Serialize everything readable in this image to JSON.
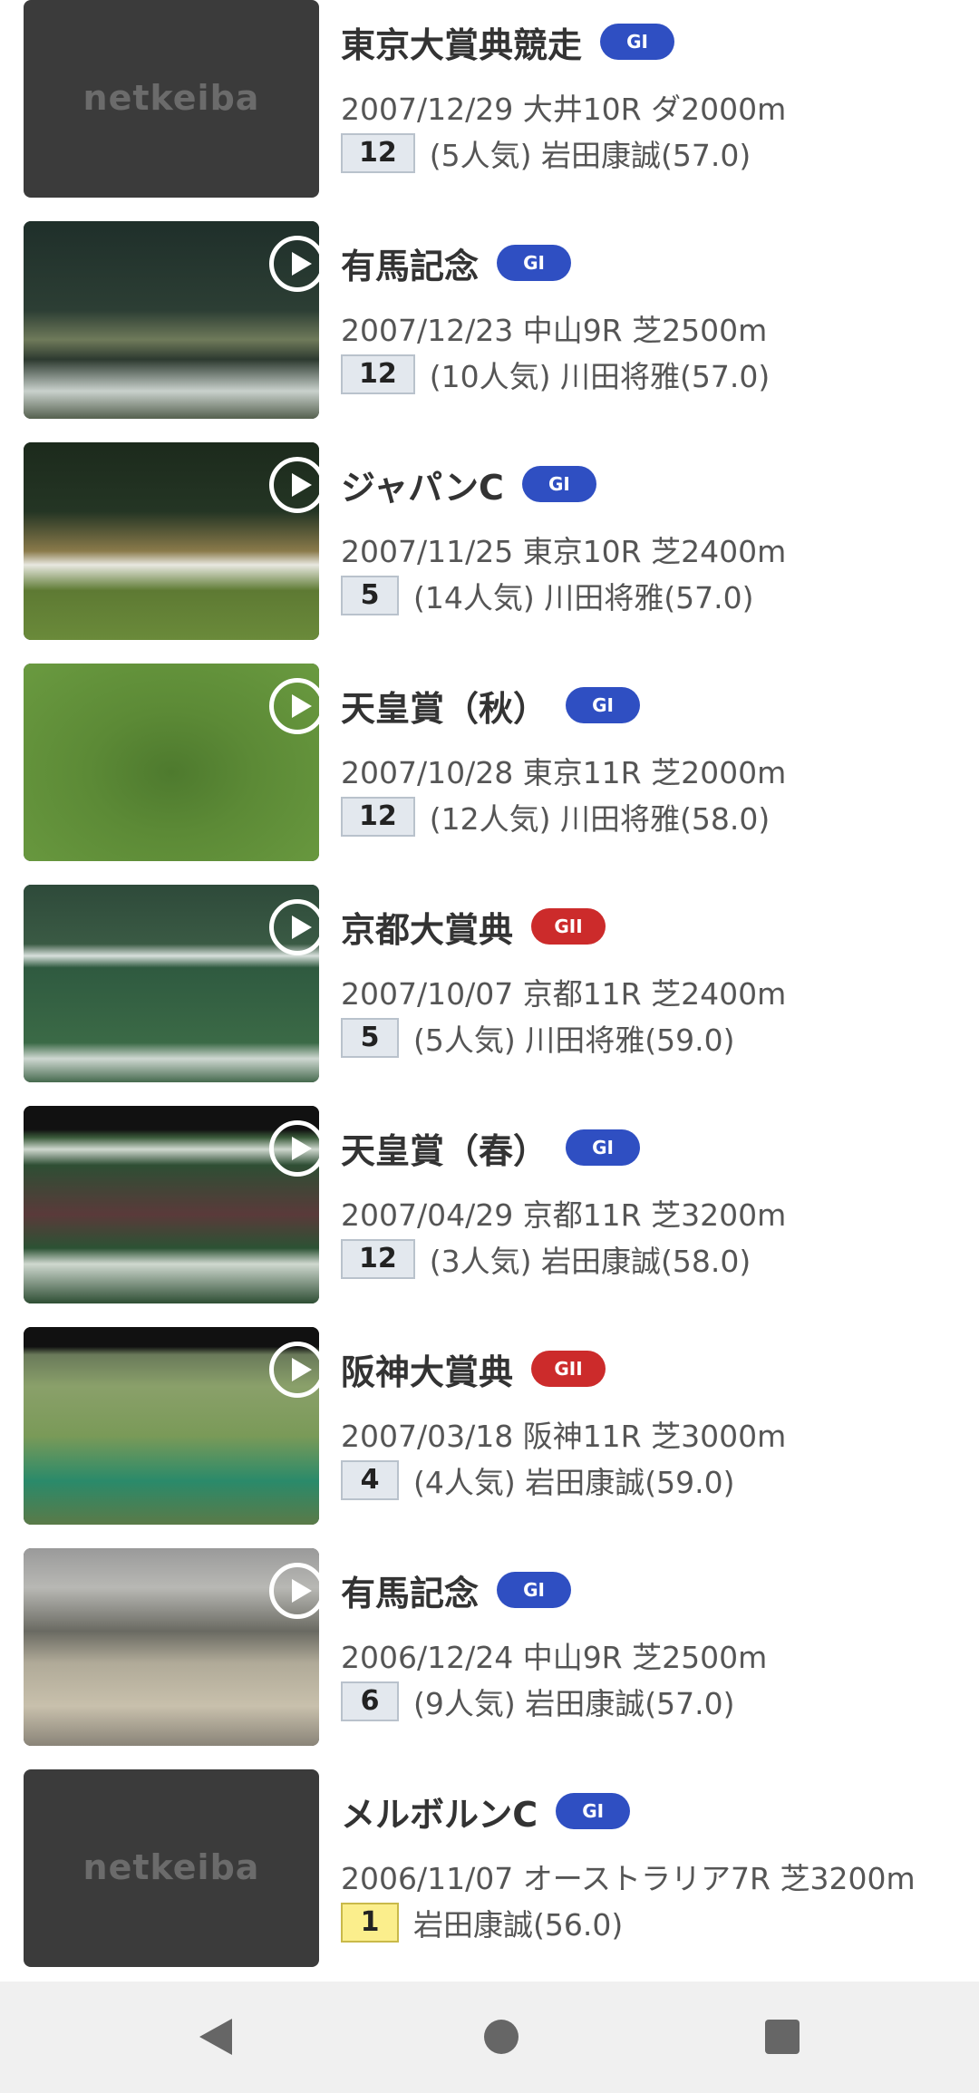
{
  "colors": {
    "grade_gi": "#2f4fc2",
    "grade_gii": "#cc2b2b",
    "winner_badge": "#fbee8c"
  },
  "races": [
    {
      "name": "東京大賞典競走",
      "grade": "GI",
      "meta": "2007/12/29 大井10R ダ2000m",
      "rank": "12",
      "result": "(5人気) 岩田康誠(57.0)",
      "video": false,
      "thumb_text": "netkeiba"
    },
    {
      "name": "有馬記念",
      "grade": "GI",
      "meta": "2007/12/23 中山9R 芝2500m",
      "rank": "12",
      "result": "(10人気) 川田将雅(57.0)",
      "video": true
    },
    {
      "name": "ジャパンC",
      "grade": "GI",
      "meta": "2007/11/25 東京10R 芝2400m",
      "rank": "5",
      "result": "(14人気) 川田将雅(57.0)",
      "video": true
    },
    {
      "name": "天皇賞（秋）",
      "grade": "GI",
      "meta": "2007/10/28 東京11R 芝2000m",
      "rank": "12",
      "result": "(12人気) 川田将雅(58.0)",
      "video": true
    },
    {
      "name": "京都大賞典",
      "grade": "GII",
      "meta": "2007/10/07 京都11R 芝2400m",
      "rank": "5",
      "result": "(5人気) 川田将雅(59.0)",
      "video": true
    },
    {
      "name": "天皇賞（春）",
      "grade": "GI",
      "meta": "2007/04/29 京都11R 芝3200m",
      "rank": "12",
      "result": "(3人気) 岩田康誠(58.0)",
      "video": true
    },
    {
      "name": "阪神大賞典",
      "grade": "GII",
      "meta": "2007/03/18 阪神11R 芝3000m",
      "rank": "4",
      "result": "(4人気) 岩田康誠(59.0)",
      "video": true
    },
    {
      "name": "有馬記念",
      "grade": "GI",
      "meta": "2006/12/24 中山9R 芝2500m",
      "rank": "6",
      "result": "(9人気) 岩田康誠(57.0)",
      "video": true
    },
    {
      "name": "メルボルンC",
      "grade": "GI",
      "meta": "2006/11/07 オーストラリア7R 芝3200m",
      "rank": "1",
      "result": "岩田康誠(56.0)",
      "video": false,
      "thumb_text": "netkeiba"
    }
  ],
  "navbar": {
    "back_icon": "triangle-back",
    "home_icon": "circle-home",
    "recent_icon": "square-recents"
  }
}
